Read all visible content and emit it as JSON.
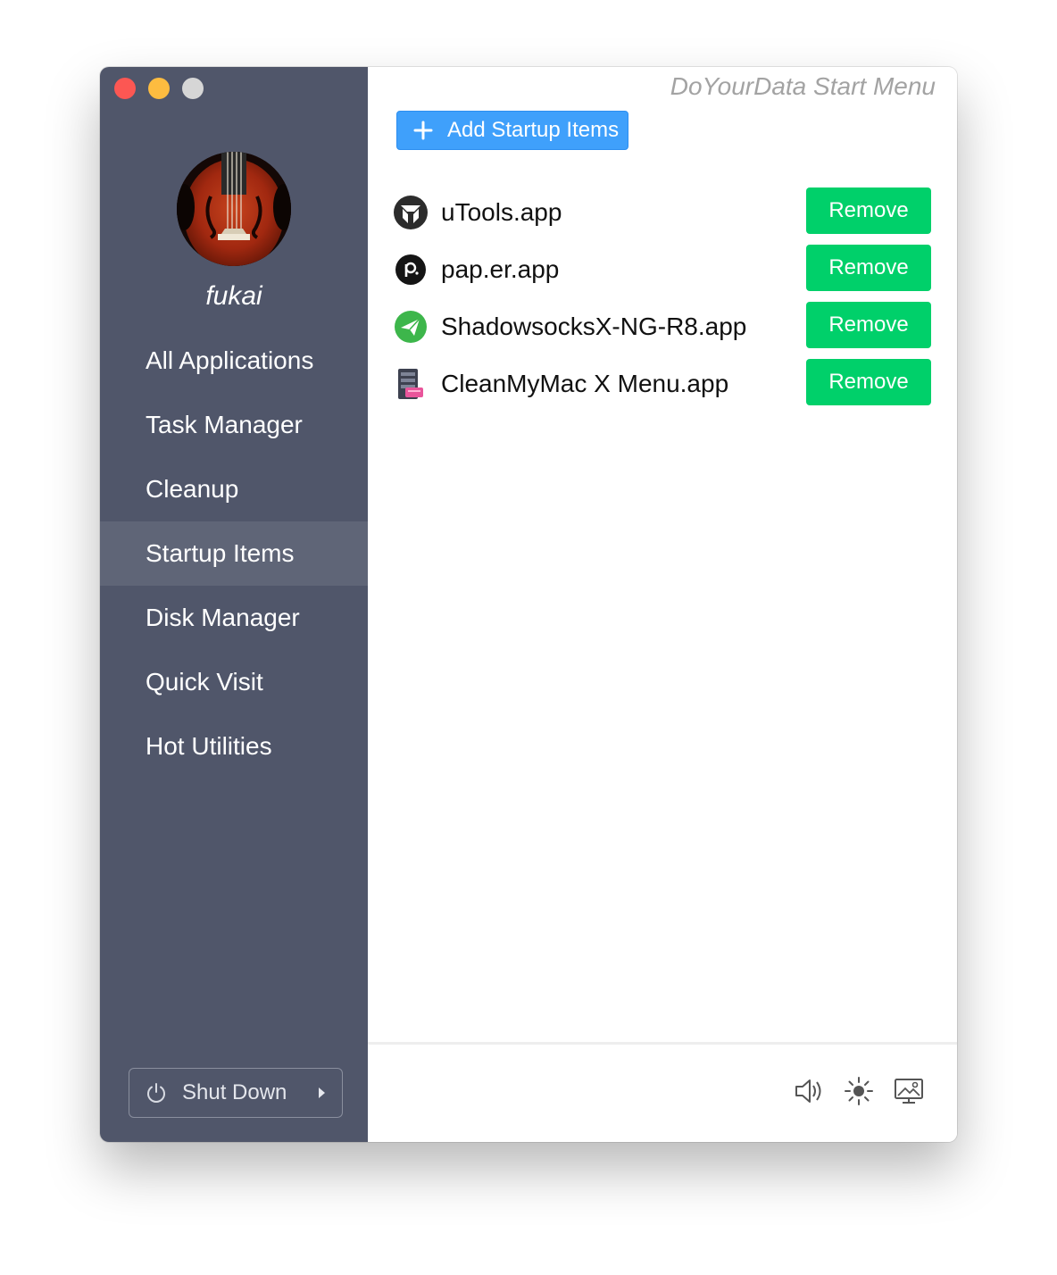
{
  "window": {
    "brand": "DoYourData Start Menu",
    "controls": [
      "close",
      "minimize",
      "zoom"
    ]
  },
  "sidebar": {
    "username": "fukai",
    "avatar_icon": "violin-avatar",
    "items": [
      {
        "label": "All Applications",
        "active": false
      },
      {
        "label": "Task Manager",
        "active": false
      },
      {
        "label": "Cleanup",
        "active": false
      },
      {
        "label": "Startup Items",
        "active": true
      },
      {
        "label": "Disk Manager",
        "active": false
      },
      {
        "label": "Quick Visit",
        "active": false
      },
      {
        "label": "Hot Utilities",
        "active": false
      }
    ],
    "shutdown": {
      "label": "Shut Down",
      "icon": "power-icon",
      "arrow_icon": "caret-right-icon"
    }
  },
  "main": {
    "add_button": {
      "label": "Add Startup Items",
      "icon": "plus-icon"
    },
    "startup_items": [
      {
        "name": "uTools.app",
        "icon": "utools-icon",
        "action": "Remove"
      },
      {
        "name": "pap.er.app",
        "icon": "paper-icon",
        "action": "Remove"
      },
      {
        "name": "ShadowsocksX-NG-R8.app",
        "icon": "paper-plane-icon",
        "action": "Remove"
      },
      {
        "name": "CleanMyMac X Menu.app",
        "icon": "cleanmymac-icon",
        "action": "Remove"
      }
    ]
  },
  "footer": {
    "icons": [
      "volume-icon",
      "brightness-icon",
      "display-icon"
    ]
  },
  "colors": {
    "sidebar_bg": "#50566a",
    "sidebar_active": "#5f6577",
    "add_button": "#3fa0fb",
    "remove_button": "#00d06a",
    "brand_text": "#a3a3a3"
  }
}
